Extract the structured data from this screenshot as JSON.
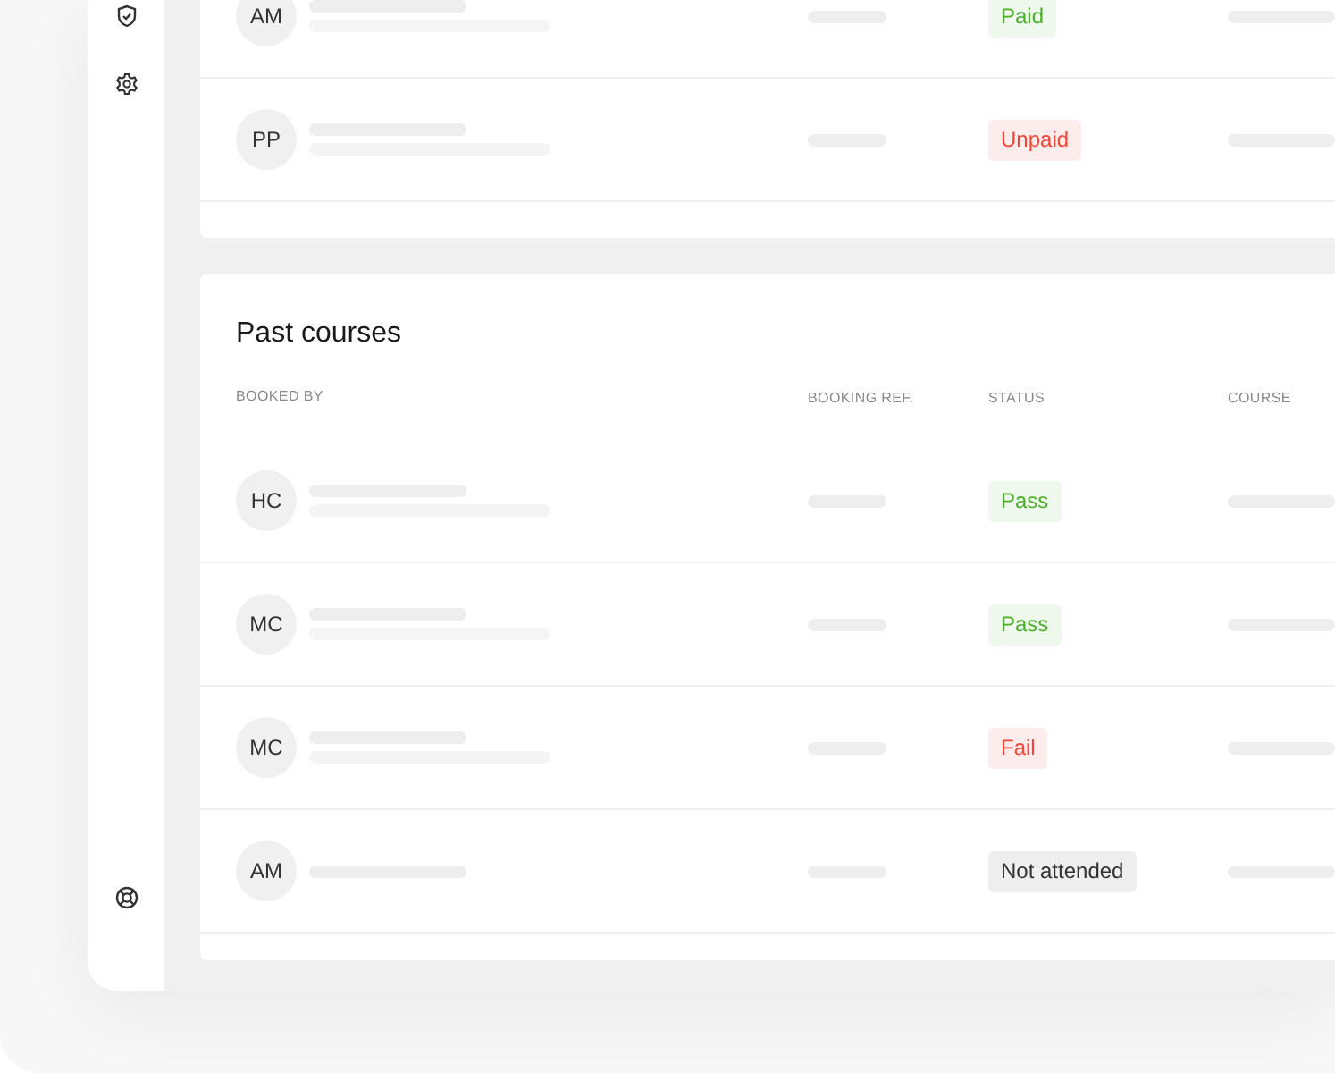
{
  "upcoming": {
    "rows": [
      {
        "initials": "AM",
        "two_line": true,
        "status": {
          "label": "Paid",
          "kind": "success"
        }
      },
      {
        "initials": "PP",
        "two_line": true,
        "status": {
          "label": "Unpaid",
          "kind": "error"
        }
      }
    ]
  },
  "past_courses": {
    "title": "Past courses",
    "columns": [
      "BOOKED BY",
      "BOOKING REF.",
      "STATUS",
      "COURSE"
    ],
    "rows": [
      {
        "initials": "HC",
        "two_line": true,
        "status": {
          "label": "Pass",
          "kind": "success"
        }
      },
      {
        "initials": "MC",
        "two_line": true,
        "status": {
          "label": "Pass",
          "kind": "success"
        }
      },
      {
        "initials": "MC",
        "two_line": true,
        "status": {
          "label": "Fail",
          "kind": "error"
        }
      },
      {
        "initials": "AM",
        "two_line": false,
        "status": {
          "label": "Not attended",
          "kind": "neutral"
        }
      }
    ]
  }
}
